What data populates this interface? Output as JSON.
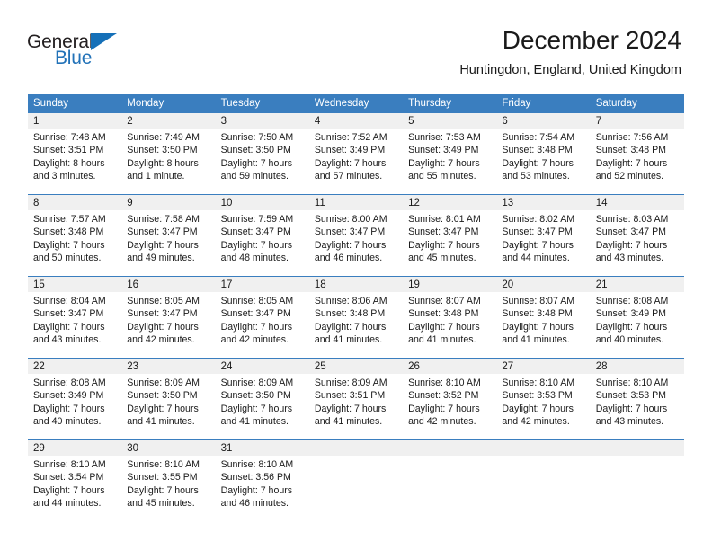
{
  "brand": {
    "name_part1": "General",
    "name_part2": "Blue",
    "accent_color": "#1570b8"
  },
  "header": {
    "title": "December 2024",
    "subtitle": "Huntingdon, England, United Kingdom"
  },
  "calendar": {
    "header_bg": "#3a7ebf",
    "weekdays": [
      "Sunday",
      "Monday",
      "Tuesday",
      "Wednesday",
      "Thursday",
      "Friday",
      "Saturday"
    ],
    "weeks": [
      [
        {
          "day": "1",
          "sunrise": "Sunrise: 7:48 AM",
          "sunset": "Sunset: 3:51 PM",
          "daylight_line1": "Daylight: 8 hours",
          "daylight_line2": "and 3 minutes."
        },
        {
          "day": "2",
          "sunrise": "Sunrise: 7:49 AM",
          "sunset": "Sunset: 3:50 PM",
          "daylight_line1": "Daylight: 8 hours",
          "daylight_line2": "and 1 minute."
        },
        {
          "day": "3",
          "sunrise": "Sunrise: 7:50 AM",
          "sunset": "Sunset: 3:50 PM",
          "daylight_line1": "Daylight: 7 hours",
          "daylight_line2": "and 59 minutes."
        },
        {
          "day": "4",
          "sunrise": "Sunrise: 7:52 AM",
          "sunset": "Sunset: 3:49 PM",
          "daylight_line1": "Daylight: 7 hours",
          "daylight_line2": "and 57 minutes."
        },
        {
          "day": "5",
          "sunrise": "Sunrise: 7:53 AM",
          "sunset": "Sunset: 3:49 PM",
          "daylight_line1": "Daylight: 7 hours",
          "daylight_line2": "and 55 minutes."
        },
        {
          "day": "6",
          "sunrise": "Sunrise: 7:54 AM",
          "sunset": "Sunset: 3:48 PM",
          "daylight_line1": "Daylight: 7 hours",
          "daylight_line2": "and 53 minutes."
        },
        {
          "day": "7",
          "sunrise": "Sunrise: 7:56 AM",
          "sunset": "Sunset: 3:48 PM",
          "daylight_line1": "Daylight: 7 hours",
          "daylight_line2": "and 52 minutes."
        }
      ],
      [
        {
          "day": "8",
          "sunrise": "Sunrise: 7:57 AM",
          "sunset": "Sunset: 3:48 PM",
          "daylight_line1": "Daylight: 7 hours",
          "daylight_line2": "and 50 minutes."
        },
        {
          "day": "9",
          "sunrise": "Sunrise: 7:58 AM",
          "sunset": "Sunset: 3:47 PM",
          "daylight_line1": "Daylight: 7 hours",
          "daylight_line2": "and 49 minutes."
        },
        {
          "day": "10",
          "sunrise": "Sunrise: 7:59 AM",
          "sunset": "Sunset: 3:47 PM",
          "daylight_line1": "Daylight: 7 hours",
          "daylight_line2": "and 48 minutes."
        },
        {
          "day": "11",
          "sunrise": "Sunrise: 8:00 AM",
          "sunset": "Sunset: 3:47 PM",
          "daylight_line1": "Daylight: 7 hours",
          "daylight_line2": "and 46 minutes."
        },
        {
          "day": "12",
          "sunrise": "Sunrise: 8:01 AM",
          "sunset": "Sunset: 3:47 PM",
          "daylight_line1": "Daylight: 7 hours",
          "daylight_line2": "and 45 minutes."
        },
        {
          "day": "13",
          "sunrise": "Sunrise: 8:02 AM",
          "sunset": "Sunset: 3:47 PM",
          "daylight_line1": "Daylight: 7 hours",
          "daylight_line2": "and 44 minutes."
        },
        {
          "day": "14",
          "sunrise": "Sunrise: 8:03 AM",
          "sunset": "Sunset: 3:47 PM",
          "daylight_line1": "Daylight: 7 hours",
          "daylight_line2": "and 43 minutes."
        }
      ],
      [
        {
          "day": "15",
          "sunrise": "Sunrise: 8:04 AM",
          "sunset": "Sunset: 3:47 PM",
          "daylight_line1": "Daylight: 7 hours",
          "daylight_line2": "and 43 minutes."
        },
        {
          "day": "16",
          "sunrise": "Sunrise: 8:05 AM",
          "sunset": "Sunset: 3:47 PM",
          "daylight_line1": "Daylight: 7 hours",
          "daylight_line2": "and 42 minutes."
        },
        {
          "day": "17",
          "sunrise": "Sunrise: 8:05 AM",
          "sunset": "Sunset: 3:47 PM",
          "daylight_line1": "Daylight: 7 hours",
          "daylight_line2": "and 42 minutes."
        },
        {
          "day": "18",
          "sunrise": "Sunrise: 8:06 AM",
          "sunset": "Sunset: 3:48 PM",
          "daylight_line1": "Daylight: 7 hours",
          "daylight_line2": "and 41 minutes."
        },
        {
          "day": "19",
          "sunrise": "Sunrise: 8:07 AM",
          "sunset": "Sunset: 3:48 PM",
          "daylight_line1": "Daylight: 7 hours",
          "daylight_line2": "and 41 minutes."
        },
        {
          "day": "20",
          "sunrise": "Sunrise: 8:07 AM",
          "sunset": "Sunset: 3:48 PM",
          "daylight_line1": "Daylight: 7 hours",
          "daylight_line2": "and 41 minutes."
        },
        {
          "day": "21",
          "sunrise": "Sunrise: 8:08 AM",
          "sunset": "Sunset: 3:49 PM",
          "daylight_line1": "Daylight: 7 hours",
          "daylight_line2": "and 40 minutes."
        }
      ],
      [
        {
          "day": "22",
          "sunrise": "Sunrise: 8:08 AM",
          "sunset": "Sunset: 3:49 PM",
          "daylight_line1": "Daylight: 7 hours",
          "daylight_line2": "and 40 minutes."
        },
        {
          "day": "23",
          "sunrise": "Sunrise: 8:09 AM",
          "sunset": "Sunset: 3:50 PM",
          "daylight_line1": "Daylight: 7 hours",
          "daylight_line2": "and 41 minutes."
        },
        {
          "day": "24",
          "sunrise": "Sunrise: 8:09 AM",
          "sunset": "Sunset: 3:50 PM",
          "daylight_line1": "Daylight: 7 hours",
          "daylight_line2": "and 41 minutes."
        },
        {
          "day": "25",
          "sunrise": "Sunrise: 8:09 AM",
          "sunset": "Sunset: 3:51 PM",
          "daylight_line1": "Daylight: 7 hours",
          "daylight_line2": "and 41 minutes."
        },
        {
          "day": "26",
          "sunrise": "Sunrise: 8:10 AM",
          "sunset": "Sunset: 3:52 PM",
          "daylight_line1": "Daylight: 7 hours",
          "daylight_line2": "and 42 minutes."
        },
        {
          "day": "27",
          "sunrise": "Sunrise: 8:10 AM",
          "sunset": "Sunset: 3:53 PM",
          "daylight_line1": "Daylight: 7 hours",
          "daylight_line2": "and 42 minutes."
        },
        {
          "day": "28",
          "sunrise": "Sunrise: 8:10 AM",
          "sunset": "Sunset: 3:53 PM",
          "daylight_line1": "Daylight: 7 hours",
          "daylight_line2": "and 43 minutes."
        }
      ],
      [
        {
          "day": "29",
          "sunrise": "Sunrise: 8:10 AM",
          "sunset": "Sunset: 3:54 PM",
          "daylight_line1": "Daylight: 7 hours",
          "daylight_line2": "and 44 minutes."
        },
        {
          "day": "30",
          "sunrise": "Sunrise: 8:10 AM",
          "sunset": "Sunset: 3:55 PM",
          "daylight_line1": "Daylight: 7 hours",
          "daylight_line2": "and 45 minutes."
        },
        {
          "day": "31",
          "sunrise": "Sunrise: 8:10 AM",
          "sunset": "Sunset: 3:56 PM",
          "daylight_line1": "Daylight: 7 hours",
          "daylight_line2": "and 46 minutes."
        },
        {
          "day": "",
          "sunrise": "",
          "sunset": "",
          "daylight_line1": "",
          "daylight_line2": ""
        },
        {
          "day": "",
          "sunrise": "",
          "sunset": "",
          "daylight_line1": "",
          "daylight_line2": ""
        },
        {
          "day": "",
          "sunrise": "",
          "sunset": "",
          "daylight_line1": "",
          "daylight_line2": ""
        },
        {
          "day": "",
          "sunrise": "",
          "sunset": "",
          "daylight_line1": "",
          "daylight_line2": ""
        }
      ]
    ]
  }
}
